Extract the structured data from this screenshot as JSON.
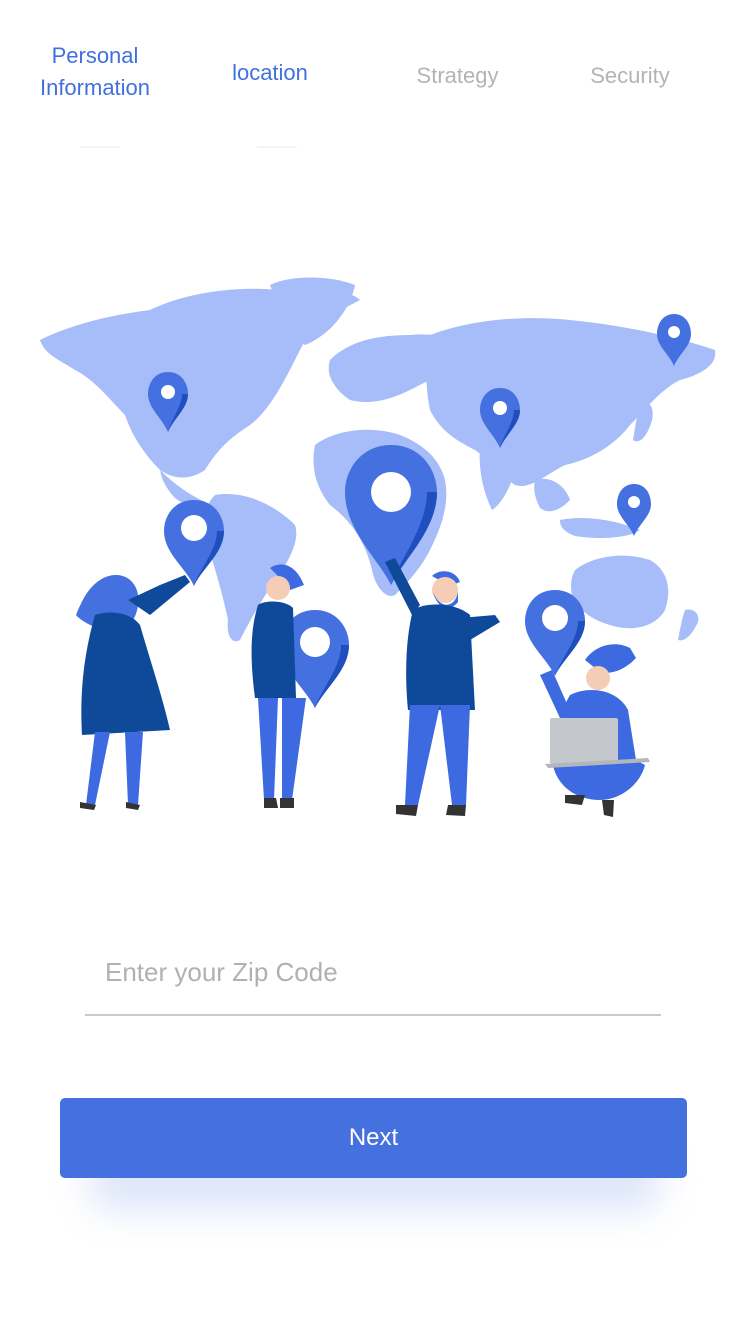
{
  "steps": [
    {
      "label": "Personal\nInformation",
      "state": "done"
    },
    {
      "label": "location",
      "state": "active"
    },
    {
      "label": "Strategy",
      "state": "pending"
    },
    {
      "label": "Security",
      "state": "pending"
    }
  ],
  "illustration": {
    "name": "world-map-people-location-pins",
    "colors": {
      "map": "#a6bdf9",
      "pin": "#4470e0",
      "pin_dark": "#1f4fbf",
      "dark_cloth": "#0e4a99",
      "light_cloth": "#3d6ae0",
      "laptop": "#c4c7cc",
      "skin": "#f5cdb6"
    }
  },
  "zip": {
    "placeholder": "Enter your Zip Code",
    "value": ""
  },
  "next_button": {
    "label": "Next"
  },
  "colors": {
    "accent": "#4470e0",
    "inactive_text": "#b3b3b8",
    "divider": "#c9c9cd"
  }
}
